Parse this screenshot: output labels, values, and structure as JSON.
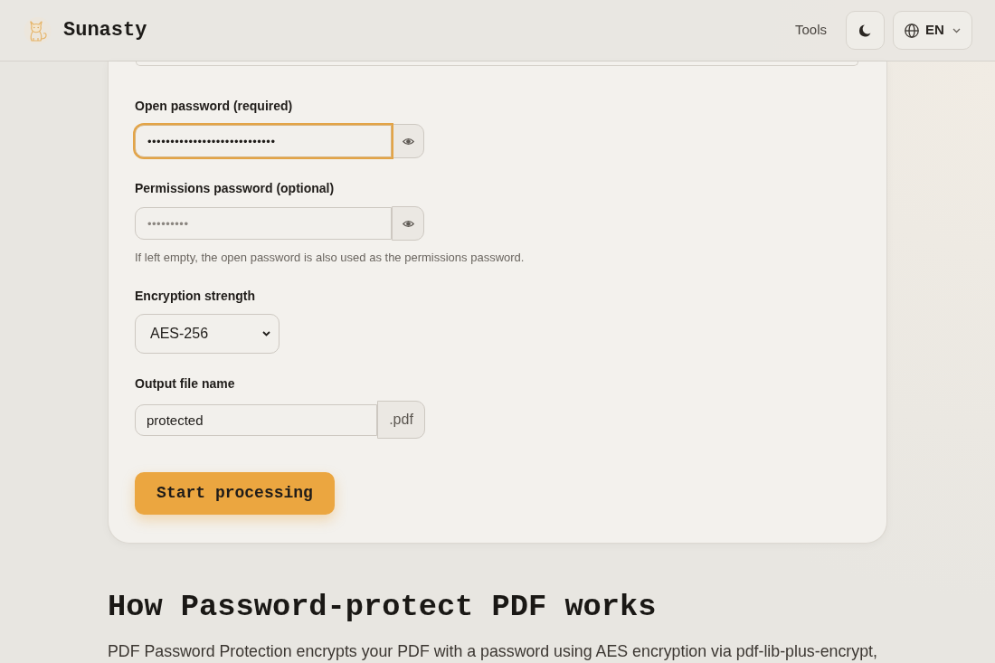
{
  "header": {
    "brand": "Sunasty",
    "nav": [
      "Tools"
    ],
    "language": "EN"
  },
  "form": {
    "fields": [
      {
        "kind": "password",
        "label": "Open password (required)",
        "value": "••••••••••••••••••••••••••••",
        "focused": true
      },
      {
        "kind": "password",
        "label": "Permissions password (optional)",
        "placeholder": "•••••••••",
        "hint": "If left empty, the open password is also used as the permissions password.",
        "focused": false
      },
      {
        "kind": "select",
        "label": "Encryption strength",
        "value": "AES-256",
        "focused": false
      },
      {
        "kind": "filename",
        "label": "Output file name",
        "value": "protected",
        "suffix": ".pdf",
        "focused": false
      }
    ],
    "submit": "Start processing"
  },
  "section": {
    "heading": "How Password-protect PDF works",
    "text": "PDF Password Protection encrypts your PDF with a password using AES encryption via pdf-lib-plus-encrypt,"
  }
}
